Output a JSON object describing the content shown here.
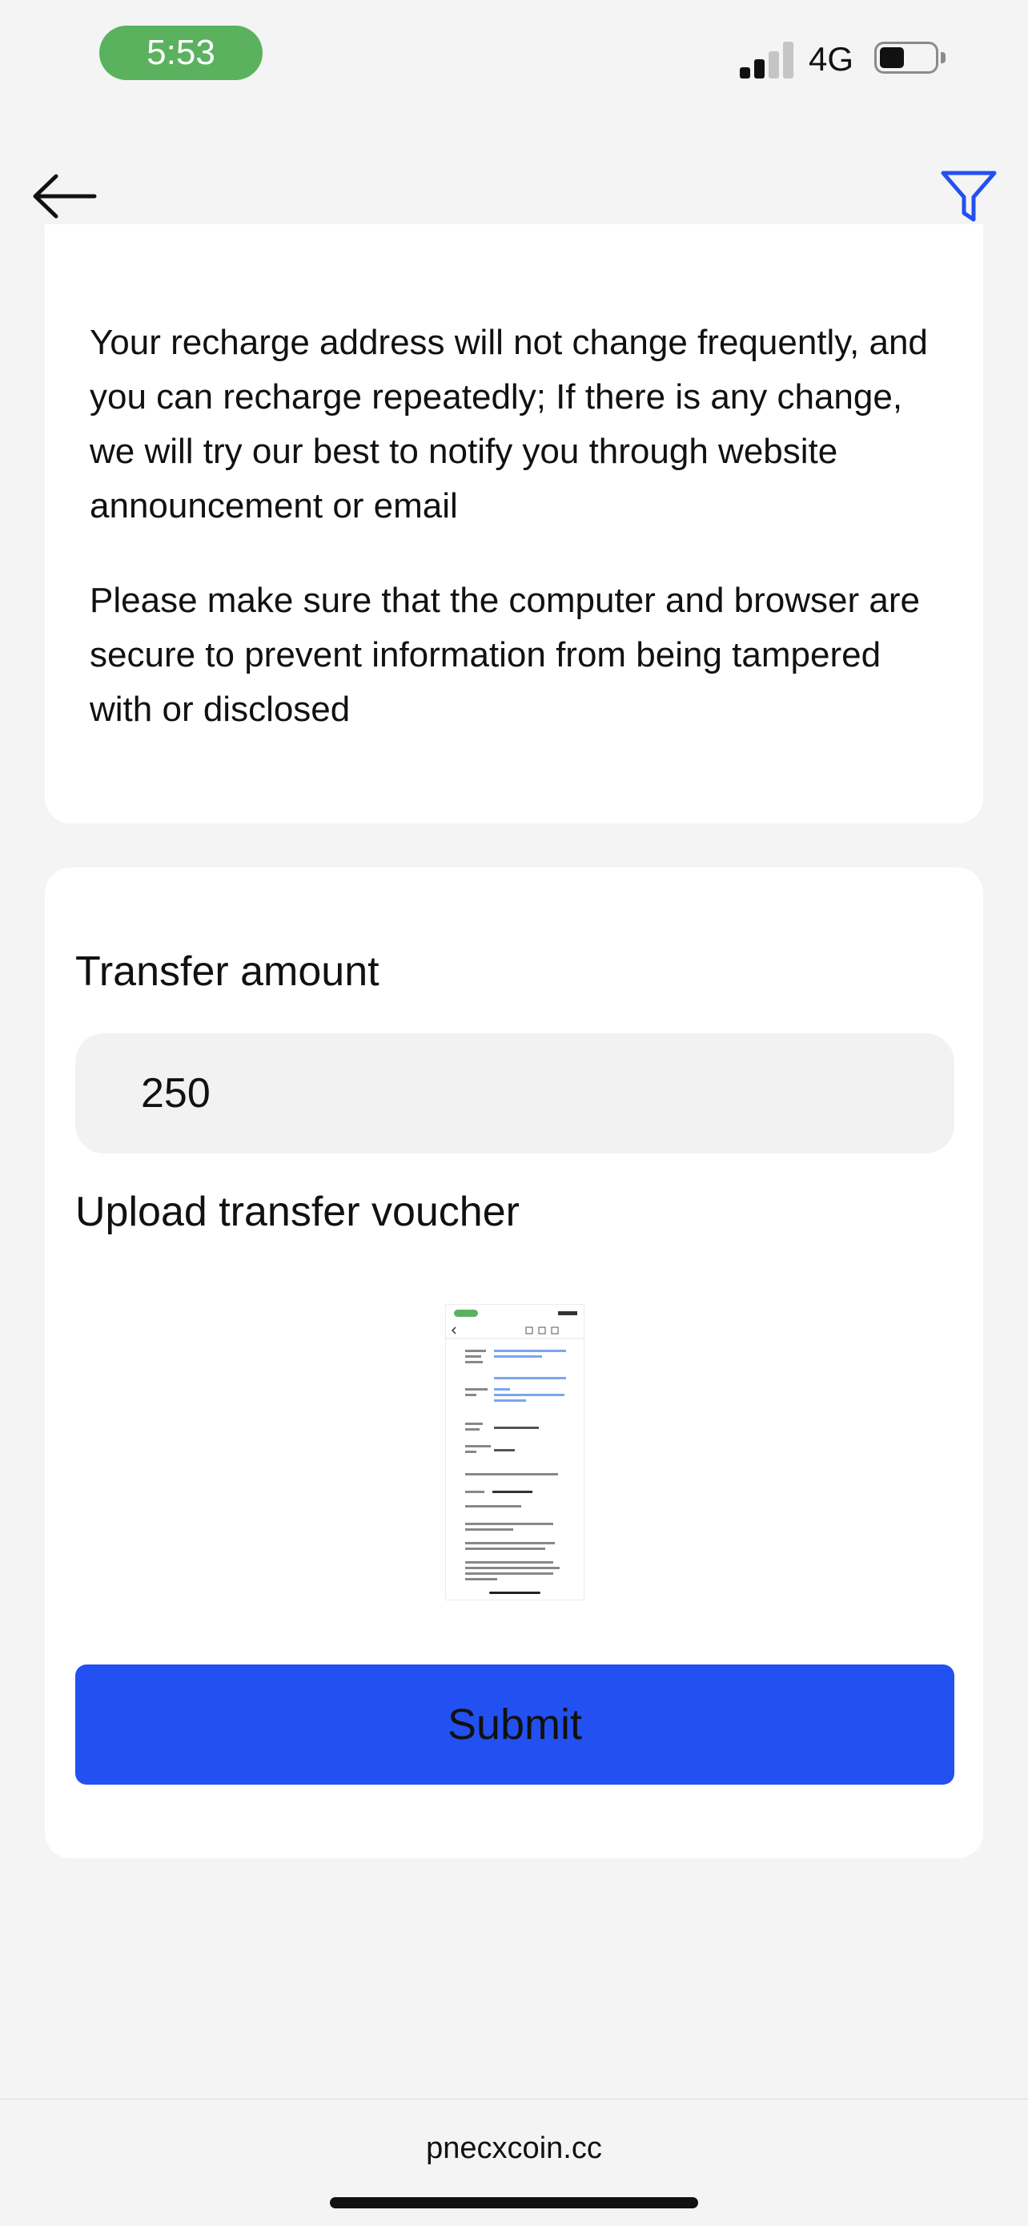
{
  "status_bar": {
    "time": "5:53",
    "network": "4G",
    "time_pill_color": "#5ab25e",
    "signal_icon": "cellular-signal-icon",
    "battery_icon": "battery-icon"
  },
  "nav": {
    "back_icon": "arrow-left-icon",
    "filter_icon": "filter-icon",
    "accent_color": "#2350f0"
  },
  "notice": {
    "paragraphs": [
      "Your recharge address will not change frequently, and you can recharge repeatedly; If there is any change, we will try our best to notify you through website announcement or email",
      "Please make sure that the computer and browser are secure to prevent information from being tampered with or disclosed"
    ]
  },
  "form": {
    "amount_label": "Transfer amount",
    "amount_value": "250",
    "upload_label": "Upload transfer voucher",
    "voucher_preview": "uploaded-voucher-thumbnail",
    "submit_label": "Submit",
    "submit_color": "#2350f0"
  },
  "footer": {
    "domain": "pnecxcoin.cc"
  }
}
